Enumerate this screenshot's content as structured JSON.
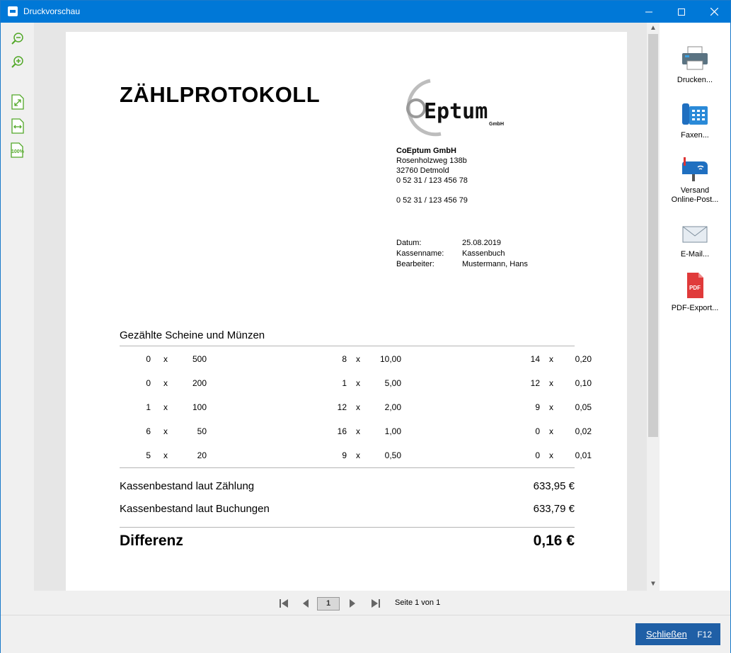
{
  "window": {
    "title": "Druckvorschau",
    "min": "—",
    "max": "☐",
    "close": "✕"
  },
  "left_tools": [
    {
      "name": "zoom-out-icon"
    },
    {
      "name": "zoom-in-icon"
    },
    {
      "name": "fit-page-icon"
    },
    {
      "name": "fit-width-icon"
    },
    {
      "name": "zoom-100-icon",
      "label": "100%"
    }
  ],
  "right_tools": {
    "print": "Drucken...",
    "fax": "Faxen...",
    "mail_line1": "Versand",
    "mail_line2": "Online-Post...",
    "email": "E-Mail...",
    "pdf": "PDF-Export...",
    "pdf_badge": "PDF"
  },
  "document": {
    "title": "ZÄHLPROTOKOLL",
    "logo_text": "Eptum",
    "logo_sub": "GmbH",
    "company": "CoEptum GmbH",
    "street": "Rosenholzweg 138b",
    "city": "32760 Detmold",
    "phone": "0 52 31 / 123 456 78",
    "fax": "0 52 31 / 123 456 79",
    "meta": {
      "date_label": "Datum:",
      "date": "25.08.2019",
      "register_label": "Kassenname:",
      "register": "Kassenbuch",
      "user_label": "Bearbeiter:",
      "user": "Mustermann, Hans"
    },
    "section_title": "Gezählte Scheine und Münzen",
    "counts": [
      [
        {
          "n": "0",
          "v": "500"
        },
        {
          "n": "8",
          "v": "10,00"
        },
        {
          "n": "14",
          "v": "0,20"
        }
      ],
      [
        {
          "n": "0",
          "v": "200"
        },
        {
          "n": "1",
          "v": "5,00"
        },
        {
          "n": "12",
          "v": "0,10"
        }
      ],
      [
        {
          "n": "1",
          "v": "100"
        },
        {
          "n": "12",
          "v": "2,00"
        },
        {
          "n": "9",
          "v": "0,05"
        }
      ],
      [
        {
          "n": "6",
          "v": "50"
        },
        {
          "n": "16",
          "v": "1,00"
        },
        {
          "n": "0",
          "v": "0,02"
        }
      ],
      [
        {
          "n": "5",
          "v": "20"
        },
        {
          "n": "9",
          "v": "0,50"
        },
        {
          "n": "0",
          "v": "0,01"
        }
      ]
    ],
    "times": "x",
    "sum_count_label": "Kassenbestand laut Zählung",
    "sum_count": "633,95 €",
    "sum_book_label": "Kassenbestand laut Buchungen",
    "sum_book": "633,79 €",
    "diff_label": "Differenz",
    "diff": "0,16 €"
  },
  "pager": {
    "page": "1",
    "info": "Seite 1 von 1",
    "first": "⏮",
    "prev": "◀",
    "next": "▶",
    "last": "⏭"
  },
  "footer": {
    "close_label": "Schließen",
    "close_key": "F12"
  },
  "colors": {
    "titlebar": "#0078d7",
    "accent_green": "#52a828",
    "close_button": "#1f5fa6"
  }
}
